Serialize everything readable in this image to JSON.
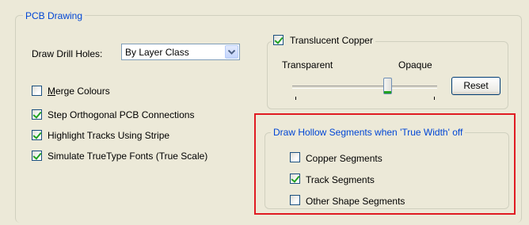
{
  "pcb_group": {
    "title": "PCB Drawing"
  },
  "drill_holes": {
    "label": "Draw Drill Holes:",
    "selected": "By Layer Class"
  },
  "checkboxes": {
    "merge_colours": {
      "label": "Merge Colours",
      "checked": false
    },
    "step_orthogonal": {
      "label": "Step Orthogonal PCB Connections",
      "checked": true
    },
    "highlight_tracks": {
      "label": "Highlight Tracks Using Stripe",
      "checked": true
    },
    "simulate_truetype": {
      "label": "Simulate TrueType Fonts (True Scale)",
      "checked": true
    }
  },
  "translucent_group": {
    "title": "Translucent Copper",
    "checked": true,
    "transparent_label": "Transparent",
    "opaque_label": "Opaque",
    "reset_label": "Reset",
    "slider_value": 0.72
  },
  "hollow_group": {
    "title": "Draw Hollow Segments when 'True Width' off",
    "items": [
      {
        "label": "Copper Segments",
        "checked": false
      },
      {
        "label": "Track Segments",
        "checked": true
      },
      {
        "label": "Other Shape Segments",
        "checked": false
      }
    ]
  },
  "colors": {
    "group_title": "#0046d5",
    "highlight": "#e01b22",
    "check": "#21a121"
  }
}
